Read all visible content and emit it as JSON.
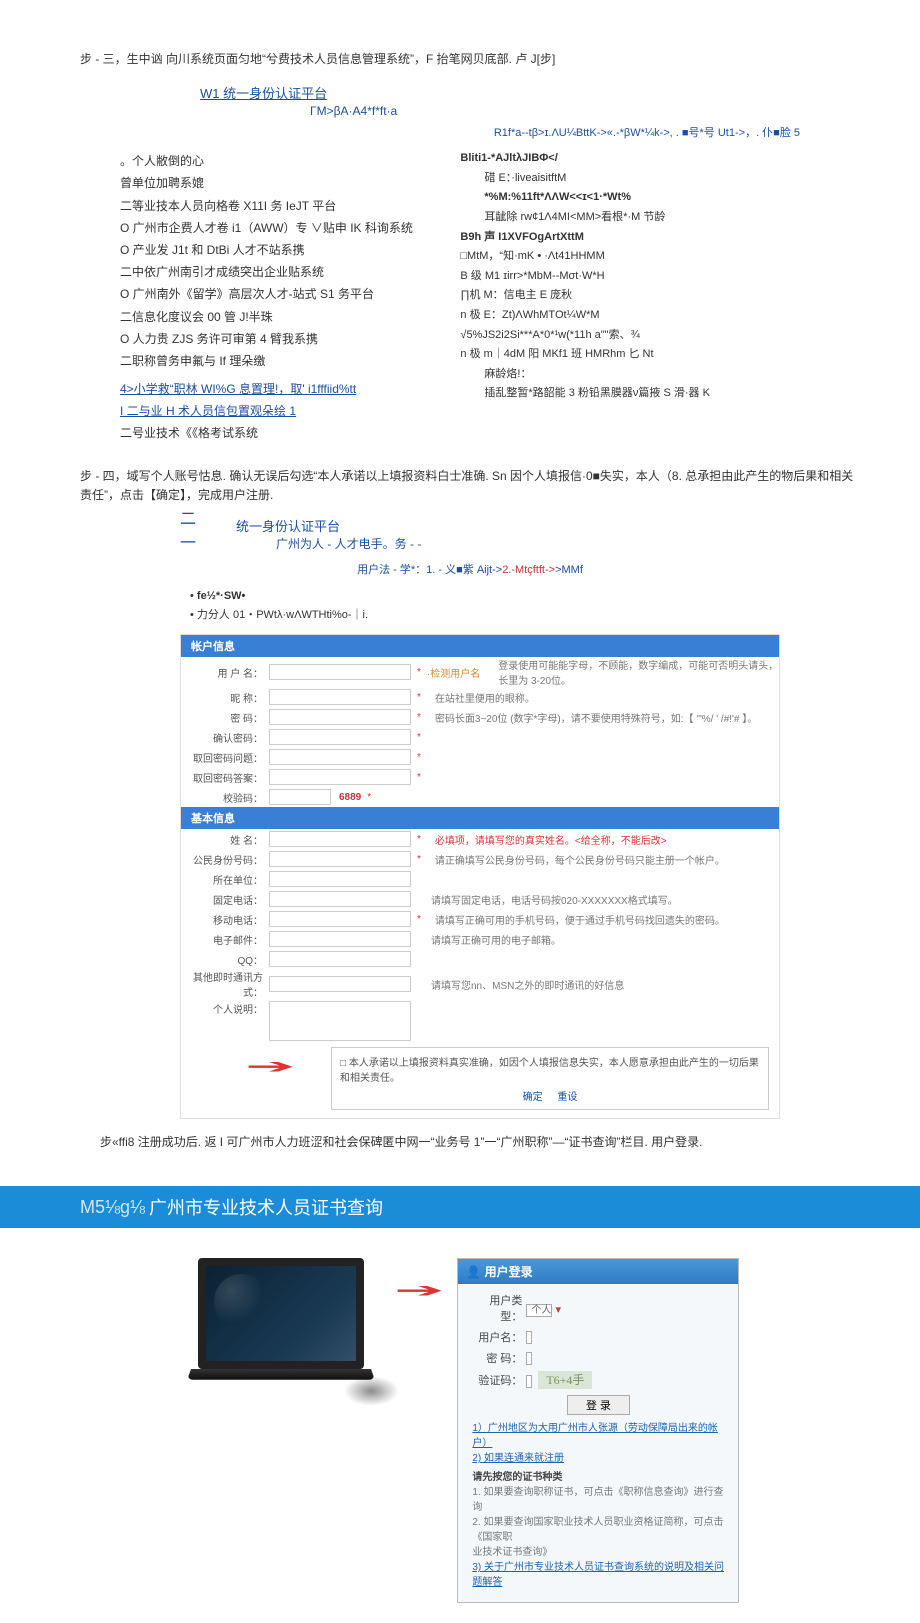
{
  "step3_header": "步 - 三，生中讻 向川系统页面匀地“兮费技术人员信息管理系统”，F 抬笔网贝底部. 卢 J[步]",
  "platform_header": "W1 统一身份认证平台",
  "platform_sub": "ΓM>βA·A4*f*ft·a",
  "top_crumb_parts": [
    "R1f*a--tβ>ɪ.ΛU¼BttK->«.-*βW*¼k->, . ■号*号 Ut1->，. 仆■脸 5"
  ],
  "sys_list": [
    "。个人敝倒的心",
    "曾单位加聘系媲",
    "二等业技本人员向格卷 X11I 务 IeJT 平台",
    "O 广州市企费人才卷 i1（AWW）专 ∨贴申 IK 科询系统",
    "O 产业发 J1t 和 DtBi 人才不站系携",
    "二中依广州南引才成绩突出企业贴系统",
    "O 广州南外《留学》高层次人才-站式 S1 务平台",
    "二信息化度议会 00 管 J!半珠",
    "O 人力贵 ZJS 务许可审第 4 臂我系携",
    "二职称曾务申氟与 If 理朵缴"
  ],
  "sys_hilite1": "4>小学救“职林 WI%G 息置理!，取' i1fffiid%tt",
  "sys_hilite2": "I 二与业 H 术人员信包置观朵绘 1",
  "sys_last": "二号业技术《《格考试系统",
  "right_lines": [
    "Bliti1-*AJltλJIBΦ</",
    "碏 E：·liveaisitftM",
    "*%M:%11ft*ΛΛW<<ɪ<1·*Wt%",
    "耳龇除 rw¢1Λ4MI<MM>看根*·M 节龄",
    "B9h 声 I1XVFOgArtXttM",
    "□MtM，“知·mK • ·Λt41HHMM",
    "B 级 M1      ɪirr>*MbM--Mσt·W*H",
    "∏机 M：信电主 E 庞秋",
    "n 极 E：Zt)ΛWhMTOt¼W*M",
    "√5%JS2i2Si***A*0*¹w(*11h         a\"\"索、¾",
    "n 极 m｜4dM 阳 MKf1 班 HMRhm 匕 Nt",
    "麻龄烙!：",
    "插乱整暂*路韶能 3 粉铅黑膜器ν篇掖 S 滑·器 K"
  ],
  "step4_text": "步 - 四，域写个人账号怙息. 确认无误后勾选“本人承诺以上填报资料白士准确. Sn 因个人填报信·0■失实，本人（8. 总承担由此产生的物后果和相关责任”，点击【确定】，完成用户注册.",
  "platform_header2": "统一身份认证平台",
  "platform_sub2": "广州为人 - 人才电手。务 - -",
  "crumb2_parts": {
    "p1": "用户法 - 学*：1. - 义■紫 Aijt->",
    "p2": "2.-Mtçftft->",
    "p3": ">MMf"
  },
  "cred_note": [
    "fe½*·SW•",
    "力分人 01・PWtλ·wΛWTHti%o-｜i."
  ],
  "form": {
    "band1": "帐户信息",
    "r_user_lbl": "用 户 名：",
    "r_user_chk": "·检测用户名",
    "r_user_hint": "登录使用可能能字母，不顾能，数字编成，可能可否明头请头，长里为 3-20位。",
    "r_nick_lbl": "昵  称：",
    "r_nick_hint": "在站社里便用的眼称。",
    "r_pwd_lbl": "密  码：",
    "r_pwd_hint": "密码长面3~20位 (数字*字母)，请不要使用特殊符号，如:【 '\"%/ ' /#!'# 】。",
    "r_pwd2_lbl": "确认密码：",
    "r_q_lbl": "取回密码问题：",
    "r_a_lbl": "取回密码答案：",
    "r_cap_lbl": "校验码：",
    "r_cap_val": "6889",
    "band2": "基本信息",
    "r_name_lbl": "姓  名：",
    "r_name_hint": "必填项，请填写您的真实姓名。<给全称，不能后改>",
    "r_id_lbl": "公民身份号码：",
    "r_id_hint": "请正确填写公民身份号码，每个公民身份号码只能主册一个帐户。",
    "r_unit_lbl": "所在单位：",
    "r_tel_lbl": "固定电话：",
    "r_tel_hint": "请填写固定电话，电话号码按020-XXXXXXX格式填写。",
    "r_mob_lbl": "移动电话：",
    "r_mob_hint": "请填写正确可用的手机号码，便于通过手机号码找回遗失的密码。",
    "r_mail_lbl": "电子邮件：",
    "r_mail_hint": "请填写正确可用的电子邮箱。",
    "r_qq_lbl": "QQ：",
    "r_addr_lbl": "其他即时通讯方式：",
    "r_addr_hint": "请填写您nn、MSN之外的即时通讯的好信息",
    "r_intro_lbl": "个人说明：",
    "agree_text": "□ 本人承诺以上填报资料真实准确，如因个人填报信息失实，本人愿意承担由此产生的一切后果和相关责任。",
    "btn_ok": "确定",
    "btn_reset": "重设"
  },
  "step5_text": "步«ffi8 注册成功后. 返 I 可广州市人力班涩和社会保碑匿中网一“业务号 1”一“广州职称”—“证书查询”栏目. 用户登录.",
  "banner_pre": "M5⅛g⅛",
  "banner_main": "广州市专业技术人员证书查询",
  "login": {
    "hdr_icon": "👤",
    "hdr": "用户登录",
    "type_lbl": "用户类型：",
    "type_val": "个人",
    "user_lbl": "用户名：",
    "pwd_lbl": "密  码：",
    "cap_lbl": "验证码：",
    "cap_img": "T6+4手",
    "btn": "登 录",
    "note1": "1）广州地区为大用广州市人张源（劳动保障局出来的帐户）",
    "note2": "2) 如果连通来就注册",
    "note_hd": "请先按您的证书种类",
    "note3": "1. 如果要查询职称证书，可点击《职称信息查询》进行查询",
    "note4": "2. 如果要查询国家职业技术人员职业资格证简称，可点击《国家职",
    "note5": "业技术证书查询》",
    "note6": "3) 关于广州市专业技术人员证书查询系统的说明及相关问题解答"
  }
}
